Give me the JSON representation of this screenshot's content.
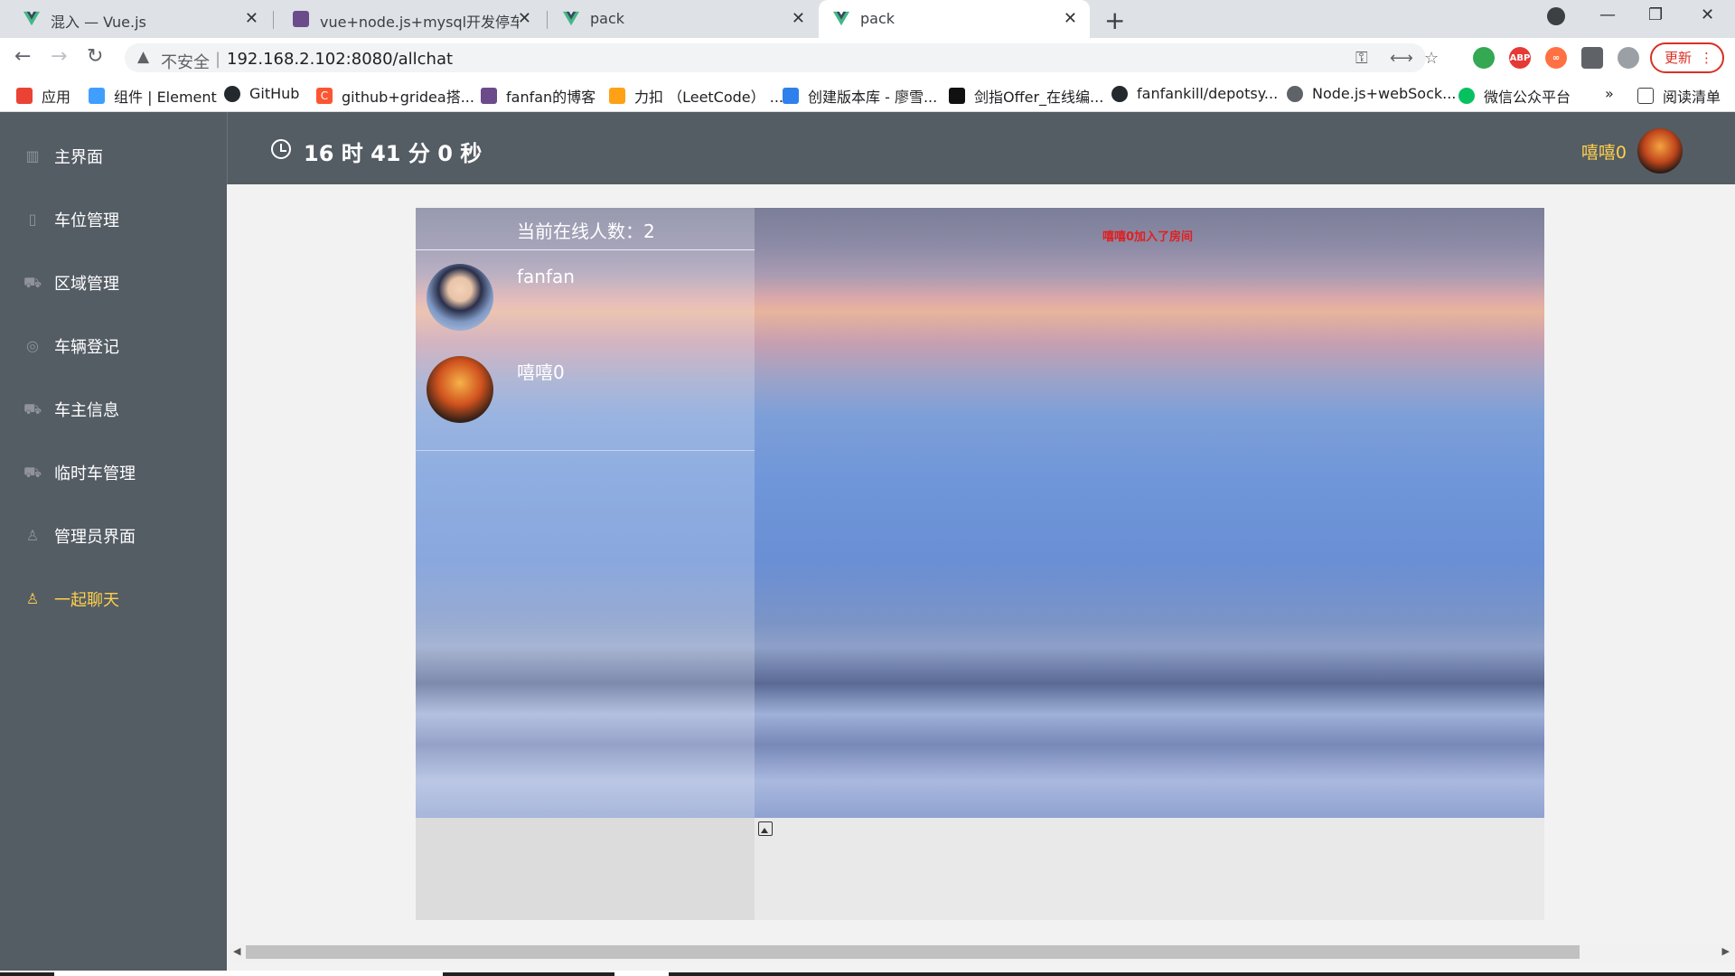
{
  "browser": {
    "tabs": [
      {
        "title": "混入 — Vue.js",
        "icon": "vue-logo-icon"
      },
      {
        "title": "vue+node.js+mysql开发停车场",
        "icon": "blog-avatar-icon"
      },
      {
        "title": "pack",
        "icon": "vue-logo-icon"
      },
      {
        "title": "pack",
        "icon": "vue-logo-icon",
        "active": true
      }
    ],
    "new_tab": "+",
    "window_controls": [
      "—",
      "❐",
      "✕"
    ],
    "address": {
      "insecure_label": "不安全",
      "separator": "|",
      "url": "192.168.2.102:8080/allchat"
    },
    "update_button": "更新",
    "bookmarks": [
      {
        "label": "应用",
        "icon": "apps-grid-icon",
        "color": "#ea4335"
      },
      {
        "label": "组件 | Element",
        "icon": "element-logo-icon",
        "color": "#409eff"
      },
      {
        "label": "GitHub",
        "icon": "github-icon",
        "color": "#24292e"
      },
      {
        "label": "github+gridea搭...",
        "icon": "csdn-icon",
        "color": "#fc5531"
      },
      {
        "label": "fanfan的博客",
        "icon": "blog-avatar-icon",
        "color": "#6b4b8a"
      },
      {
        "label": "力扣 （LeetCode） ...",
        "icon": "leetcode-icon",
        "color": "#ffa116"
      },
      {
        "label": "创建版本库 - 廖雪...",
        "icon": "rocket-icon",
        "color": "#2f80ed"
      },
      {
        "label": "剑指Offer_在线编...",
        "icon": "nowcoder-icon",
        "color": "#111111"
      },
      {
        "label": "fanfankill/depotsy...",
        "icon": "github-icon",
        "color": "#24292e"
      },
      {
        "label": "Node.js+webSock...",
        "icon": "globe-icon",
        "color": "#5f6368"
      },
      {
        "label": "微信公众平台",
        "icon": "wechat-icon",
        "color": "#07c160"
      }
    ],
    "bookmarks_overflow": "»",
    "reading_list": "阅读清单"
  },
  "sidebar": {
    "items": [
      {
        "label": "主界面",
        "icon": "bar-chart-icon"
      },
      {
        "label": "车位管理",
        "icon": "parking-icon"
      },
      {
        "label": "区域管理",
        "icon": "car-icon"
      },
      {
        "label": "车辆登记",
        "icon": "circle-icon"
      },
      {
        "label": "车主信息",
        "icon": "car-icon"
      },
      {
        "label": "临时车管理",
        "icon": "car-icon"
      },
      {
        "label": "管理员界面",
        "icon": "user-icon"
      },
      {
        "label": "一起聊天",
        "icon": "user-icon",
        "active": true
      }
    ],
    "colors": {
      "background": "#545c64",
      "active": "#ffd04b"
    }
  },
  "header": {
    "clock": "16 时 41 分 0 秒",
    "username": "嘻嘻0"
  },
  "chat": {
    "online_label": "当前在线人数：2",
    "users": [
      {
        "name": "fanfan"
      },
      {
        "name": "嘻嘻0"
      }
    ],
    "system_message": "嘻嘻0加入了房间",
    "system_message_color": "#e02020"
  }
}
